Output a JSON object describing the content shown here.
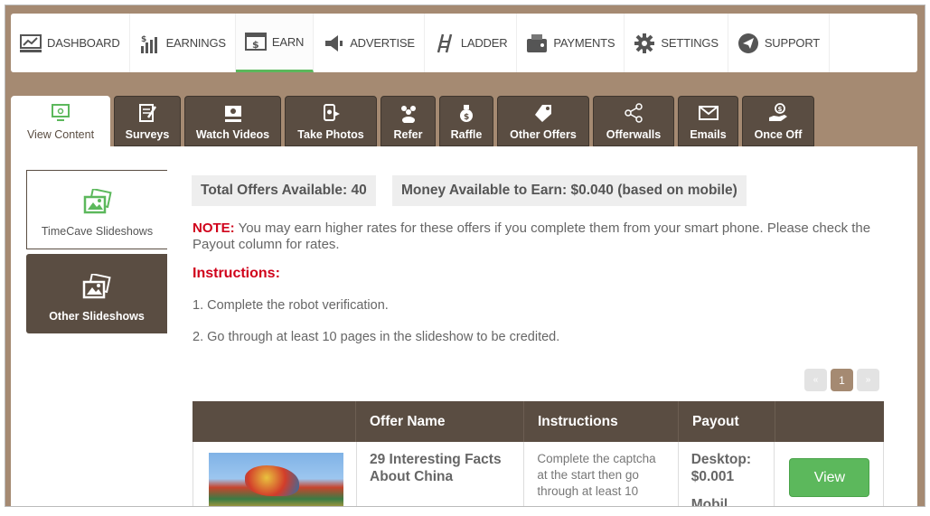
{
  "topnav": [
    {
      "label": "DASHBOARD",
      "icon": "dashboard-icon"
    },
    {
      "label": "EARNINGS",
      "icon": "earnings-icon"
    },
    {
      "label": "EARN",
      "icon": "earn-icon",
      "active": true
    },
    {
      "label": "ADVERTISE",
      "icon": "megaphone-icon"
    },
    {
      "label": "LADDER",
      "icon": "ladder-icon"
    },
    {
      "label": "PAYMENTS",
      "icon": "wallet-icon"
    },
    {
      "label": "SETTINGS",
      "icon": "gear-icon"
    },
    {
      "label": "SUPPORT",
      "icon": "paper-plane-icon"
    }
  ],
  "subtabs": [
    {
      "label": "View Content",
      "icon": "monitor-icon",
      "active": true
    },
    {
      "label": "Surveys",
      "icon": "survey-icon"
    },
    {
      "label": "Watch Videos",
      "icon": "video-icon"
    },
    {
      "label": "Take Photos",
      "icon": "camera-icon"
    },
    {
      "label": "Refer",
      "icon": "people-icon"
    },
    {
      "label": "Raffle",
      "icon": "money-bag-icon"
    },
    {
      "label": "Other Offers",
      "icon": "tag-icon"
    },
    {
      "label": "Offerwalls",
      "icon": "share-icon"
    },
    {
      "label": "Emails",
      "icon": "envelope-icon"
    },
    {
      "label": "Once Off",
      "icon": "hand-coin-icon"
    }
  ],
  "sidebar": {
    "items": [
      {
        "label": "TimeCave Slideshows",
        "icon": "images-icon",
        "active": true
      },
      {
        "label": "Other Slideshows",
        "icon": "images-icon"
      }
    ]
  },
  "summary": {
    "total": "Total Offers Available: 40",
    "money": "Money Available to Earn: $0.040 (based on mobile)"
  },
  "note": {
    "label": "NOTE:",
    "text": " You may earn higher rates for these offers if you complete them from your smart phone. Please check the Payout column for rates."
  },
  "instructions": {
    "heading": "Instructions:",
    "steps": [
      "1. Complete the robot verification.",
      "2. Go through at least 10 pages in the slideshow to be credited."
    ]
  },
  "pagination": {
    "prev": "«",
    "current": "1",
    "next": "»"
  },
  "table": {
    "headers": [
      "",
      "Offer Name",
      "Instructions",
      "Payout",
      ""
    ],
    "rows": [
      {
        "offer_name": "29 Interesting Facts About China",
        "instructions": "Complete the captcha at the start then go through at least 10",
        "payout_desktop": "Desktop: $0.001",
        "payout_more": "Mobil",
        "action": "View"
      }
    ]
  },
  "colors": {
    "brand_brown": "#5a4d42",
    "background_tan": "#a58a72",
    "accent_green": "#5cb85c",
    "note_red": "#d0021b"
  }
}
